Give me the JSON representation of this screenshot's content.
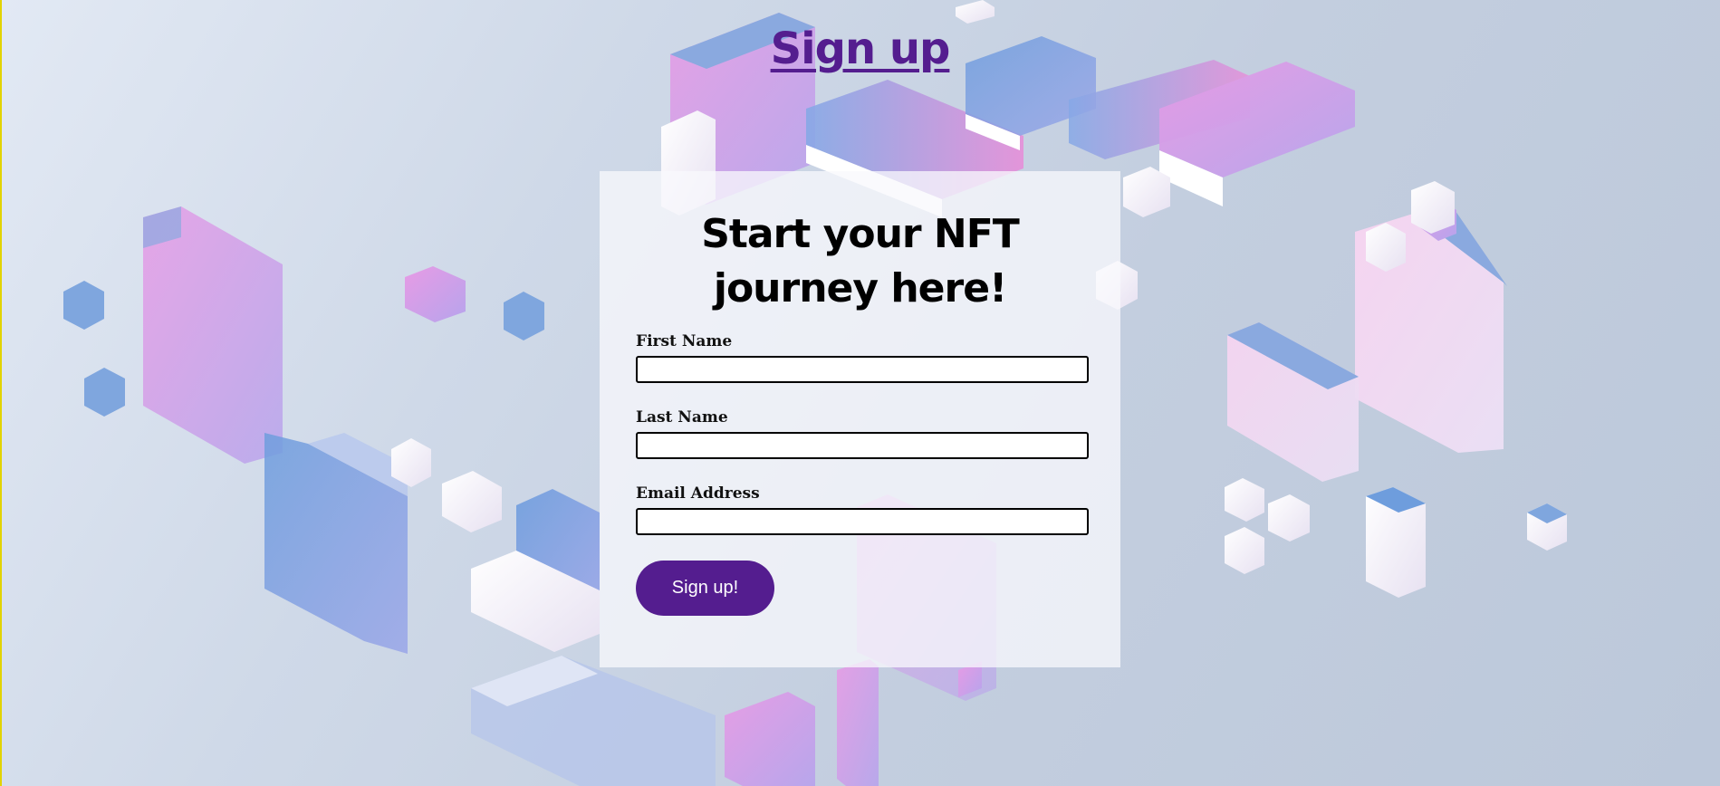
{
  "header": {
    "title": "Sign up"
  },
  "form": {
    "heading": "Start your NFT journey here!",
    "fields": [
      {
        "label": "First Name",
        "value": "",
        "placeholder": ""
      },
      {
        "label": "Last Name",
        "value": "",
        "placeholder": ""
      },
      {
        "label": "Email Address",
        "value": "",
        "placeholder": ""
      }
    ],
    "submit_label": "Sign up!"
  },
  "colors": {
    "accent": "#541d8f",
    "background": "#c9d3e4"
  }
}
